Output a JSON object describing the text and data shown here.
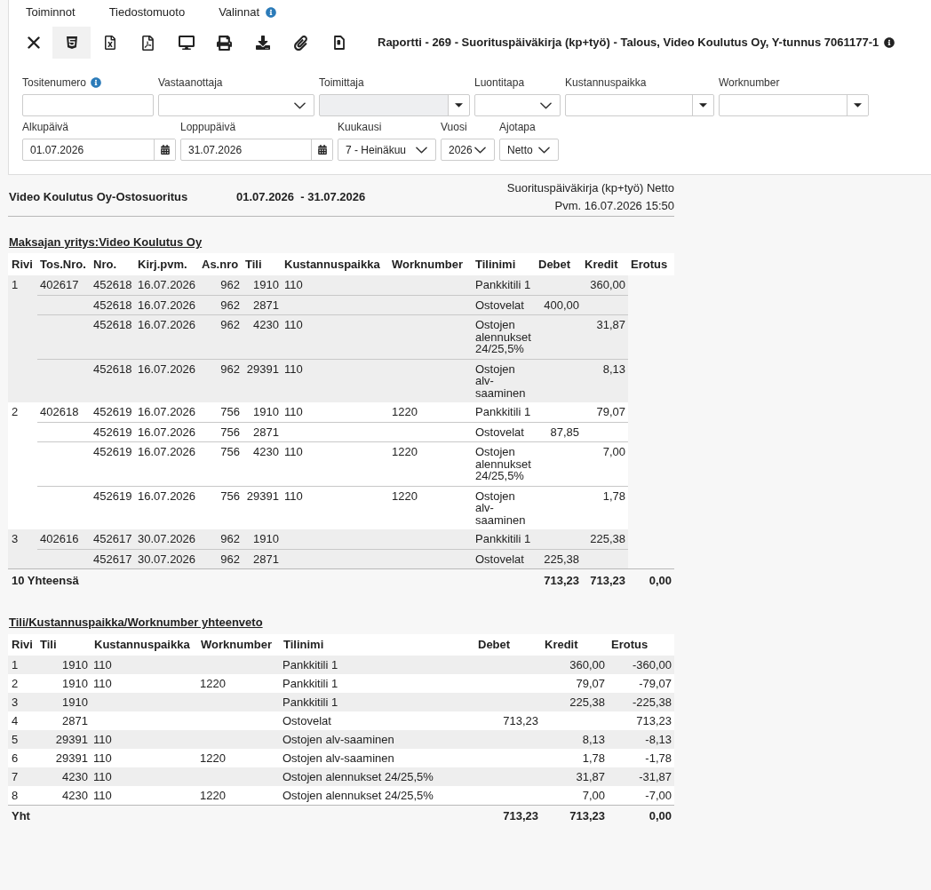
{
  "menu": [
    {
      "label": "Toiminnot"
    },
    {
      "label": "Tiedostomuoto"
    },
    {
      "label": "Valinnat",
      "info": true
    }
  ],
  "toolbar": {
    "buttons": [
      {
        "kind": "close",
        "selected": false
      },
      {
        "kind": "html",
        "selected": true
      },
      {
        "kind": "excel",
        "selected": false
      },
      {
        "kind": "pdf",
        "selected": false
      },
      {
        "kind": "screen",
        "selected": false
      },
      {
        "kind": "print",
        "selected": false
      },
      {
        "kind": "download",
        "selected": false
      },
      {
        "kind": "attachment",
        "selected": false
      },
      {
        "kind": "document",
        "selected": false
      }
    ],
    "title": "Raportti - 269 - Suorituspäiväkirja (kp+työ) - Talous, Video Koulutus Oy, Y-tunnus 7061177-1",
    "title_info": true
  },
  "filters": {
    "rows": [
      {
        "fields": [
          {
            "label": "Tositenumero",
            "kind": "text",
            "info": true,
            "disabled": false
          },
          {
            "label": "Vastaanottaja",
            "kind": "select",
            "disabled": false
          },
          {
            "label": "Toimittaja",
            "kind": "combo",
            "disabled": true
          },
          {
            "label": "Luontitapa",
            "kind": "select",
            "disabled": false
          },
          {
            "label": "Kustannuspaikka",
            "kind": "combo",
            "disabled": false
          },
          {
            "label": "Worknumber",
            "kind": "combo",
            "disabled": false
          }
        ]
      },
      {
        "fields": [
          {
            "label": "Alkupäivä",
            "kind": "date",
            "value": "01.07.2026",
            "disabled": false
          },
          {
            "label": "Loppupäivä",
            "kind": "date",
            "value": "31.07.2026",
            "disabled": false
          },
          {
            "label": "Kuukausi",
            "kind": "select",
            "value": "7 - Heinäkuu",
            "disabled": false
          },
          {
            "label": "Vuosi",
            "kind": "select",
            "value": "2026",
            "disabled": false
          },
          {
            "label": "Ajotapa",
            "kind": "select",
            "value": "Netto",
            "disabled": false
          }
        ]
      }
    ]
  },
  "report": {
    "company": "Video Koulutus Oy-Ostosuoritus",
    "period": "01.07.2026  - 31.07.2026",
    "report_name": "Suorituspäiväkirja (kp+työ) Netto",
    "printed": "Pvm. 16.07.2026 15:50"
  },
  "journal": {
    "title": "Maksajan yritys:Video Koulutus Oy",
    "columns": [
      "Rivi",
      "Tos.Nro.",
      "Nro.",
      "Kirj.pvm.",
      "As.nro",
      "Tili",
      "Kustannuspaikka",
      "Worknumber",
      "Tilinimi",
      "Debet",
      "Kredit",
      "Erotus"
    ],
    "groups": [
      {
        "rivi": "1",
        "tos_nro": "402617",
        "rows": [
          {
            "nro": "452618",
            "date": "16.07.2026",
            "as_nro": "962",
            "tili": "1910",
            "kustannuspaikka": "110",
            "tilinimi": "Pankkitili 1",
            "kredit": "360,00"
          },
          {
            "nro": "452618",
            "date": "16.07.2026",
            "as_nro": "962",
            "tili": "2871",
            "tilinimi": "Ostovelat",
            "debet": "400,00"
          },
          {
            "nro": "452618",
            "date": "16.07.2026",
            "as_nro": "962",
            "tili": "4230",
            "kustannuspaikka": "110",
            "tilinimi": "Ostojen alennukset 24/25,5%",
            "kredit": "31,87"
          },
          {
            "nro": "452618",
            "date": "16.07.2026",
            "as_nro": "962",
            "tili": "29391",
            "kustannuspaikka": "110",
            "tilinimi": "Ostojen alv-saaminen",
            "kredit": "8,13"
          }
        ]
      },
      {
        "rivi": "2",
        "tos_nro": "402618",
        "rows": [
          {
            "nro": "452619",
            "date": "16.07.2026",
            "as_nro": "756",
            "tili": "1910",
            "kustannuspaikka": "110",
            "worknumber": "1220",
            "tilinimi": "Pankkitili 1",
            "kredit": "79,07"
          },
          {
            "nro": "452619",
            "date": "16.07.2026",
            "as_nro": "756",
            "tili": "2871",
            "tilinimi": "Ostovelat",
            "debet": "87,85"
          },
          {
            "nro": "452619",
            "date": "16.07.2026",
            "as_nro": "756",
            "tili": "4230",
            "kustannuspaikka": "110",
            "worknumber": "1220",
            "tilinimi": "Ostojen alennukset 24/25,5%",
            "kredit": "7,00"
          },
          {
            "nro": "452619",
            "date": "16.07.2026",
            "as_nro": "756",
            "tili": "29391",
            "kustannuspaikka": "110",
            "worknumber": "1220",
            "tilinimi": "Ostojen alv-saaminen",
            "kredit": "1,78"
          }
        ]
      },
      {
        "rivi": "3",
        "tos_nro": "402616",
        "rows": [
          {
            "nro": "452617",
            "date": "30.07.2026",
            "as_nro": "962",
            "tili": "1910",
            "tilinimi": "Pankkitili 1",
            "kredit": "225,38"
          },
          {
            "nro": "452617",
            "date": "30.07.2026",
            "as_nro": "962",
            "tili": "2871",
            "tilinimi": "Ostovelat",
            "debet": "225,38"
          }
        ]
      }
    ],
    "total": {
      "label": "10 Yhteensä",
      "debet": "713,23",
      "kredit": "713,23",
      "erotus": "0,00"
    }
  },
  "summary": {
    "title": "Tili/Kustannuspaikka/Worknumber yhteenveto",
    "columns": [
      "Rivi",
      "Tili",
      "Kustannuspaikka",
      "Worknumber",
      "Tilinimi",
      "Debet",
      "Kredit",
      "Erotus"
    ],
    "rows": [
      {
        "rivi": "1",
        "tili": "1910",
        "kustannuspaikka": "110",
        "tilinimi": "Pankkitili 1",
        "kredit": "360,00",
        "erotus": "-360,00"
      },
      {
        "rivi": "2",
        "tili": "1910",
        "kustannuspaikka": "110",
        "worknumber": "1220",
        "tilinimi": "Pankkitili 1",
        "kredit": "79,07",
        "erotus": "-79,07"
      },
      {
        "rivi": "3",
        "tili": "1910",
        "tilinimi": "Pankkitili 1",
        "kredit": "225,38",
        "erotus": "-225,38"
      },
      {
        "rivi": "4",
        "tili": "2871",
        "tilinimi": "Ostovelat",
        "debet": "713,23",
        "erotus": "713,23"
      },
      {
        "rivi": "5",
        "tili": "29391",
        "kustannuspaikka": "110",
        "tilinimi": "Ostojen alv-saaminen",
        "kredit": "8,13",
        "erotus": "-8,13"
      },
      {
        "rivi": "6",
        "tili": "29391",
        "kustannuspaikka": "110",
        "worknumber": "1220",
        "tilinimi": "Ostojen alv-saaminen",
        "kredit": "1,78",
        "erotus": "-1,78"
      },
      {
        "rivi": "7",
        "tili": "4230",
        "kustannuspaikka": "110",
        "tilinimi": "Ostojen alennukset 24/25,5%",
        "kredit": "31,87",
        "erotus": "-31,87"
      },
      {
        "rivi": "8",
        "tili": "4230",
        "kustannuspaikka": "110",
        "worknumber": "1220",
        "tilinimi": "Ostojen alennukset 24/25,5%",
        "kredit": "7,00",
        "erotus": "-7,00"
      }
    ],
    "total": {
      "label": "Yht",
      "debet": "713,23",
      "kredit": "713,23",
      "erotus": "0,00"
    }
  }
}
